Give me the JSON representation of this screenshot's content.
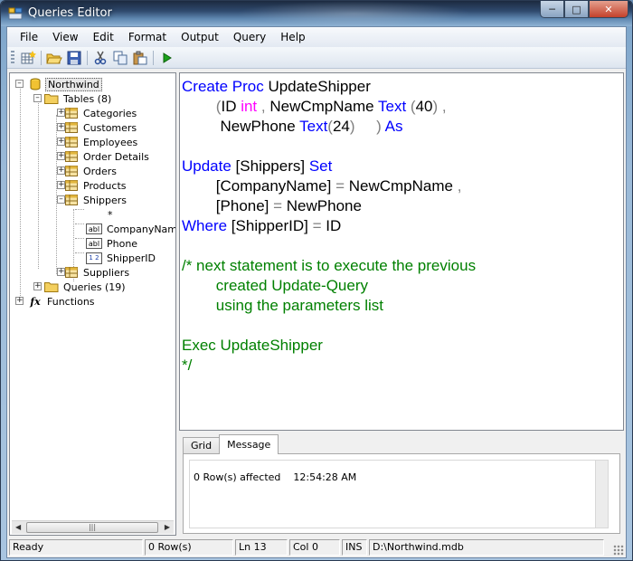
{
  "window": {
    "title": "Queries Editor"
  },
  "menu": {
    "items": [
      "File",
      "View",
      "Edit",
      "Format",
      "Output",
      "Query",
      "Help"
    ]
  },
  "toolbar": {
    "buttons": [
      "new-query-icon",
      "open-icon",
      "save-icon",
      "cut-icon",
      "copy-icon",
      "paste-icon",
      "run-icon"
    ]
  },
  "tree": {
    "root": "Northwind",
    "tables": "Tables (8)",
    "table_items": [
      "Categories",
      "Customers",
      "Employees",
      "Order Details",
      "Orders",
      "Products",
      "Shippers"
    ],
    "shipper_fields": [
      "*",
      "CompanyName",
      "Phone",
      "ShipperID"
    ],
    "field_badges": [
      "abl",
      "abl",
      "1 2"
    ],
    "last_table": "Suppliers",
    "queries": "Queries (19)",
    "functions": "Functions",
    "function_icon": "fx"
  },
  "editor": {
    "lines": [
      [
        {
          "t": "Create Proc ",
          "c": "kw"
        },
        {
          "t": "UpdateShipper",
          "c": "tx"
        }
      ],
      [
        {
          "t": "        ",
          "c": "tx"
        },
        {
          "t": "(",
          "c": "op"
        },
        {
          "t": "ID ",
          "c": "tx"
        },
        {
          "t": "int",
          "c": "ty"
        },
        {
          "t": " , ",
          "c": "op"
        },
        {
          "t": "NewCmpName ",
          "c": "tx"
        },
        {
          "t": "Text",
          "c": "kw"
        },
        {
          "t": " (",
          "c": "op"
        },
        {
          "t": "40",
          "c": "tx"
        },
        {
          "t": ") ,",
          "c": "op"
        }
      ],
      [
        {
          "t": "         ",
          "c": "tx"
        },
        {
          "t": "NewPhone ",
          "c": "tx"
        },
        {
          "t": "Text",
          "c": "kw"
        },
        {
          "t": "(",
          "c": "op"
        },
        {
          "t": "24",
          "c": "tx"
        },
        {
          "t": ")     ) ",
          "c": "op"
        },
        {
          "t": "As",
          "c": "kw"
        }
      ],
      [
        {
          "t": "",
          "c": "tx"
        }
      ],
      [
        {
          "t": "Update ",
          "c": "kw"
        },
        {
          "t": "[Shippers] ",
          "c": "tx"
        },
        {
          "t": "Set",
          "c": "kw"
        }
      ],
      [
        {
          "t": "        ",
          "c": "tx"
        },
        {
          "t": "[CompanyName] ",
          "c": "tx"
        },
        {
          "t": "= ",
          "c": "op"
        },
        {
          "t": "NewCmpName",
          "c": "tx"
        },
        {
          "t": " ,",
          "c": "op"
        }
      ],
      [
        {
          "t": "        ",
          "c": "tx"
        },
        {
          "t": "[Phone] ",
          "c": "tx"
        },
        {
          "t": "= ",
          "c": "op"
        },
        {
          "t": "NewPhone",
          "c": "tx"
        }
      ],
      [
        {
          "t": "Where ",
          "c": "kw"
        },
        {
          "t": "[ShipperID] ",
          "c": "tx"
        },
        {
          "t": "= ",
          "c": "op"
        },
        {
          "t": "ID",
          "c": "tx"
        }
      ],
      [
        {
          "t": "",
          "c": "tx"
        }
      ],
      [
        {
          "t": "/* next statement is to execute the previous",
          "c": "cm"
        }
      ],
      [
        {
          "t": "        created Update-Query",
          "c": "cm"
        }
      ],
      [
        {
          "t": "        using the parameters list",
          "c": "cm"
        }
      ],
      [
        {
          "t": "",
          "c": "tx"
        }
      ],
      [
        {
          "t": "Exec UpdateShipper",
          "c": "cm"
        }
      ],
      [
        {
          "t": "*/",
          "c": "cm"
        }
      ]
    ]
  },
  "results": {
    "tabs": [
      "Grid",
      "Message"
    ],
    "active_tab": "Message",
    "message": "0 Row(s) affected    12:54:28 AM"
  },
  "status": {
    "cells": [
      "Ready",
      "0 Row(s)",
      "Ln 13",
      "Col 0",
      "INS",
      "D:\\Northwind.mdb"
    ]
  }
}
